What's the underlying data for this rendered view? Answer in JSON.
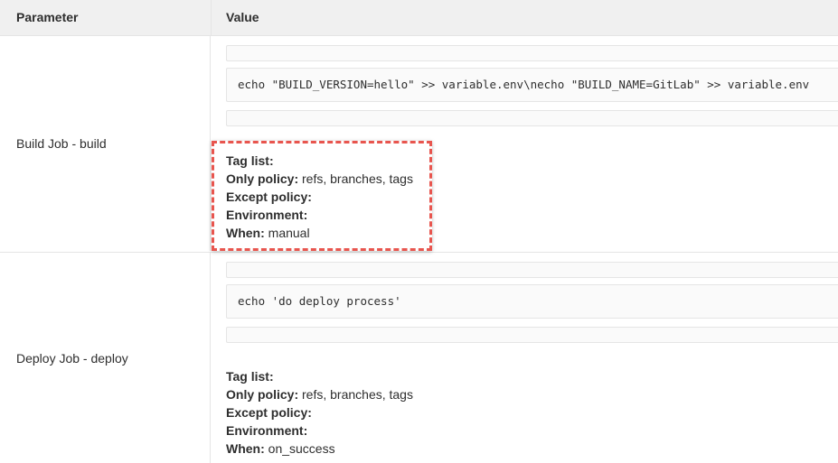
{
  "header": {
    "parameter": "Parameter",
    "value": "Value"
  },
  "jobs": [
    {
      "name": "Build Job - build",
      "script": "echo \"BUILD_VERSION=hello\" >> variable.env\\necho \"BUILD_NAME=GitLab\" >> variable.env",
      "tag_list_label": "Tag list:",
      "tag_list_value": "",
      "only_policy_label": "Only policy:",
      "only_policy_value": "refs, branches, tags",
      "except_policy_label": "Except policy:",
      "except_policy_value": "",
      "environment_label": "Environment:",
      "environment_value": "",
      "when_label": "When:",
      "when_value": "manual"
    },
    {
      "name": "Deploy Job - deploy",
      "script": "echo 'do deploy process'",
      "tag_list_label": "Tag list:",
      "tag_list_value": "",
      "only_policy_label": "Only policy:",
      "only_policy_value": "refs, branches, tags",
      "except_policy_label": "Except policy:",
      "except_policy_value": "",
      "environment_label": "Environment:",
      "environment_value": "",
      "when_label": "When:",
      "when_value": "on_success"
    }
  ],
  "colors": {
    "header_bg": "#f0f0f0",
    "code_bg": "#fafafa",
    "border": "#e5e5e5",
    "highlight": "#e8554e"
  }
}
